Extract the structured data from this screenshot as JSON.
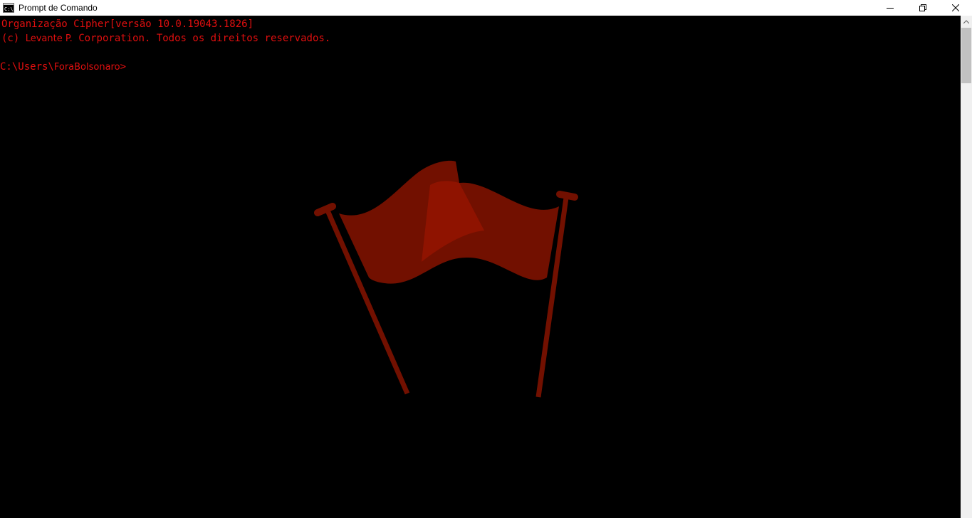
{
  "window": {
    "title": "Prompt de Comando",
    "icon": "cmd-icon"
  },
  "controls": {
    "minimize": "minimize-icon",
    "maximize": "restore-icon",
    "close": "close-icon"
  },
  "console": {
    "line1": "Organização Cipher[versão 10.0.19043.1826]",
    "line2_prefix": "(c) ",
    "line2_name": "Levante P.",
    "line2_suffix": " Corporation. Todos os direitos reservados.",
    "prompt_path": "C:\\Users\\",
    "prompt_user": "ForaBolsonaro",
    "prompt_symbol": ">"
  },
  "colors": {
    "text": "#e20f0f",
    "background": "#000000",
    "flag": "#721000",
    "flag_highlight": "#941400"
  }
}
